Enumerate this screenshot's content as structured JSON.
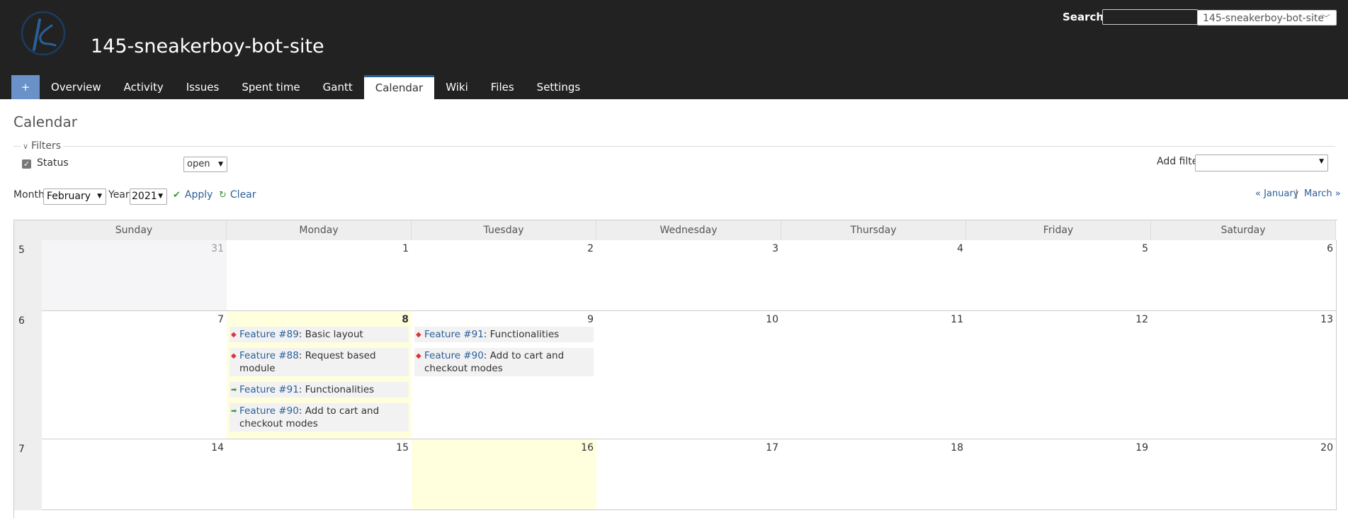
{
  "header": {
    "project_title": "145-sneakerboy-bot-site",
    "search_label": "Search:",
    "search_value": "",
    "project_jump": "145-sneakerboy-bot-site"
  },
  "menu": {
    "add": "+",
    "tabs": [
      "Overview",
      "Activity",
      "Issues",
      "Spent time",
      "Gantt",
      "Calendar",
      "Wiki",
      "Files",
      "Settings"
    ],
    "selected": "Calendar"
  },
  "page_title": "Calendar",
  "filters": {
    "legend": "Filters",
    "status_label": "Status",
    "status_operator": "open",
    "add_filter_label": "Add filter"
  },
  "period": {
    "month_label": "Month",
    "month_value": "February",
    "year_label": "Year",
    "year_value": "2021",
    "apply": "Apply",
    "clear": "Clear",
    "prev": "« January",
    "sep": "|",
    "next": "March »"
  },
  "calendar": {
    "days": [
      "Sunday",
      "Monday",
      "Tuesday",
      "Wednesday",
      "Thursday",
      "Friday",
      "Saturday"
    ],
    "weeks": [
      {
        "num": "5",
        "dates": [
          "31",
          "1",
          "2",
          "3",
          "4",
          "5",
          "6"
        ]
      },
      {
        "num": "6",
        "dates": [
          "7",
          "8",
          "9",
          "10",
          "11",
          "12",
          "13"
        ]
      },
      {
        "num": "7",
        "dates": [
          "14",
          "15",
          "16",
          "17",
          "18",
          "19",
          "20"
        ]
      }
    ],
    "issues_mon_8": [
      {
        "ref": "Feature #89",
        "title": ": Basic layout",
        "kind": "start"
      },
      {
        "ref": "Feature #88",
        "title": ": Request based module",
        "kind": "start"
      },
      {
        "ref": "Feature #91",
        "title": ": Functionalities",
        "kind": "due"
      },
      {
        "ref": "Feature #90",
        "title": ": Add to cart and checkout modes",
        "kind": "due"
      }
    ],
    "issues_tue_9": [
      {
        "ref": "Feature #91",
        "title": ": Functionalities",
        "kind": "start"
      },
      {
        "ref": "Feature #90",
        "title": ": Add to cart and checkout modes",
        "kind": "start"
      }
    ]
  },
  "colors": {
    "header_bg": "#222222",
    "accent": "#2b5f9a",
    "today": "#ffffdd"
  }
}
